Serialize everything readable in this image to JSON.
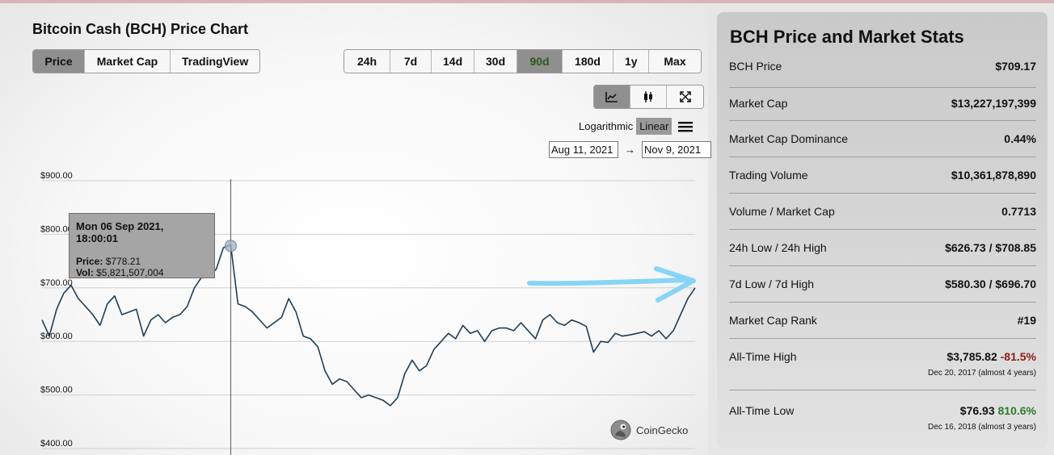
{
  "chart_title": "Bitcoin Cash (BCH) Price Chart",
  "view_tabs": [
    {
      "label": "Price",
      "active": true
    },
    {
      "label": "Market Cap",
      "active": false
    },
    {
      "label": "TradingView",
      "active": false
    }
  ],
  "range_tabs": [
    {
      "label": "24h",
      "active": false
    },
    {
      "label": "7d",
      "active": false
    },
    {
      "label": "14d",
      "active": false
    },
    {
      "label": "30d",
      "active": false
    },
    {
      "label": "90d",
      "active": true
    },
    {
      "label": "180d",
      "active": false
    },
    {
      "label": "1y",
      "active": false
    },
    {
      "label": "Max",
      "active": false
    }
  ],
  "tools": [
    {
      "icon": "line-chart-icon",
      "active": true
    },
    {
      "icon": "candlestick-icon",
      "active": false
    },
    {
      "icon": "fullscreen-icon",
      "active": false
    }
  ],
  "scale": {
    "log_label": "Logarithmic",
    "linear_label": "Linear",
    "active": "Linear",
    "menu_icon": "hamburger-menu-icon"
  },
  "dates": {
    "from": "Aug 11, 2021",
    "arrow": "→",
    "to": "Nov 9, 2021"
  },
  "tooltip": {
    "date": "Mon 06 Sep 2021, 18:00:01",
    "price_label": "Price:",
    "price_value": "$778.21",
    "vol_label": "Vol:",
    "vol_value": "$5,821,507,004"
  },
  "brand": {
    "name": "CoinGecko",
    "icon": "gecko-logo-icon"
  },
  "annotation": {
    "icon": "hand-drawn-arrow-icon",
    "color": "#7fd3f7"
  },
  "colors": {
    "line": "#1f3d57",
    "grid": "#cfcfcf",
    "positive": "#2f7a2f",
    "negative": "#8b1a1a"
  },
  "stats": {
    "title": "BCH Price and Market Stats",
    "rows": [
      {
        "label": "BCH Price",
        "value": "$709.17"
      },
      {
        "label": "Market Cap",
        "value": "$13,227,197,399"
      },
      {
        "label": "Market Cap Dominance",
        "value": "0.44%"
      },
      {
        "label": "Trading Volume",
        "value": "$10,361,878,890"
      },
      {
        "label": "Volume / Market Cap",
        "value": "0.7713"
      },
      {
        "label": "24h Low / 24h High",
        "value": "$626.73 / $708.85"
      },
      {
        "label": "7d Low / 7d High",
        "value": "$580.30 / $696.70"
      },
      {
        "label": "Market Cap Rank",
        "value": "#19"
      }
    ],
    "ath": {
      "label": "All-Time High",
      "value": "$3,785.82",
      "change": "-81.5%",
      "date": "Dec 20, 2017 (almost 4 years)"
    },
    "atl": {
      "label": "All-Time Low",
      "value": "$76.93",
      "change": "810.6%",
      "date": "Dec 16, 2018 (almost 3 years)"
    }
  },
  "chart_data": {
    "type": "line",
    "ylim": [
      400,
      900
    ],
    "y_ticks": [
      900,
      800,
      700,
      600,
      500,
      400
    ],
    "y_tick_labels": [
      "$900.00",
      "$800.00",
      "$700.00",
      "$600.00",
      "$500.00",
      "$400.00"
    ],
    "x_start": "2021-08-11",
    "x_end": "2021-11-09",
    "grid": true,
    "crosshair_x": "2021-09-06",
    "highlight": {
      "x": "2021-09-06",
      "y": 778.21
    },
    "series": [
      {
        "x": [
          "2021-08-11",
          "2021-08-12",
          "2021-08-13",
          "2021-08-14",
          "2021-08-15",
          "2021-08-16",
          "2021-08-17",
          "2021-08-18",
          "2021-08-19",
          "2021-08-20",
          "2021-08-21",
          "2021-08-22",
          "2021-08-23",
          "2021-08-24",
          "2021-08-25",
          "2021-08-26",
          "2021-08-27",
          "2021-08-28",
          "2021-08-29",
          "2021-08-30",
          "2021-08-31",
          "2021-09-01",
          "2021-09-02",
          "2021-09-03",
          "2021-09-04",
          "2021-09-05",
          "2021-09-06",
          "2021-09-07",
          "2021-09-08",
          "2021-09-09",
          "2021-09-10",
          "2021-09-11",
          "2021-09-12",
          "2021-09-13",
          "2021-09-14",
          "2021-09-15",
          "2021-09-16",
          "2021-09-17",
          "2021-09-18",
          "2021-09-19",
          "2021-09-20",
          "2021-09-21",
          "2021-09-22",
          "2021-09-23",
          "2021-09-24",
          "2021-09-25",
          "2021-09-26",
          "2021-09-27",
          "2021-09-28",
          "2021-09-29",
          "2021-09-30",
          "2021-10-01",
          "2021-10-02",
          "2021-10-03",
          "2021-10-04",
          "2021-10-05",
          "2021-10-06",
          "2021-10-07",
          "2021-10-08",
          "2021-10-09",
          "2021-10-10",
          "2021-10-11",
          "2021-10-12",
          "2021-10-13",
          "2021-10-14",
          "2021-10-15",
          "2021-10-16",
          "2021-10-17",
          "2021-10-18",
          "2021-10-19",
          "2021-10-20",
          "2021-10-21",
          "2021-10-22",
          "2021-10-23",
          "2021-10-24",
          "2021-10-25",
          "2021-10-26",
          "2021-10-27",
          "2021-10-28",
          "2021-10-29",
          "2021-10-30",
          "2021-10-31",
          "2021-11-01",
          "2021-11-02",
          "2021-11-03",
          "2021-11-04",
          "2021-11-05",
          "2021-11-06",
          "2021-11-07",
          "2021-11-08",
          "2021-11-09"
        ],
        "values": [
          640,
          610,
          660,
          690,
          705,
          680,
          665,
          650,
          630,
          670,
          685,
          650,
          655,
          660,
          610,
          640,
          650,
          635,
          645,
          650,
          665,
          700,
          720,
          720,
          735,
          775,
          780,
          670,
          665,
          655,
          640,
          625,
          635,
          645,
          680,
          655,
          610,
          605,
          590,
          545,
          520,
          530,
          525,
          510,
          495,
          500,
          495,
          490,
          480,
          495,
          540,
          565,
          545,
          555,
          585,
          600,
          615,
          605,
          630,
          615,
          620,
          600,
          620,
          625,
          625,
          620,
          635,
          620,
          605,
          640,
          650,
          635,
          630,
          640,
          635,
          628,
          580,
          600,
          598,
          615,
          610,
          612,
          615,
          618,
          610,
          620,
          605,
          620,
          650,
          680,
          700
        ]
      }
    ]
  }
}
